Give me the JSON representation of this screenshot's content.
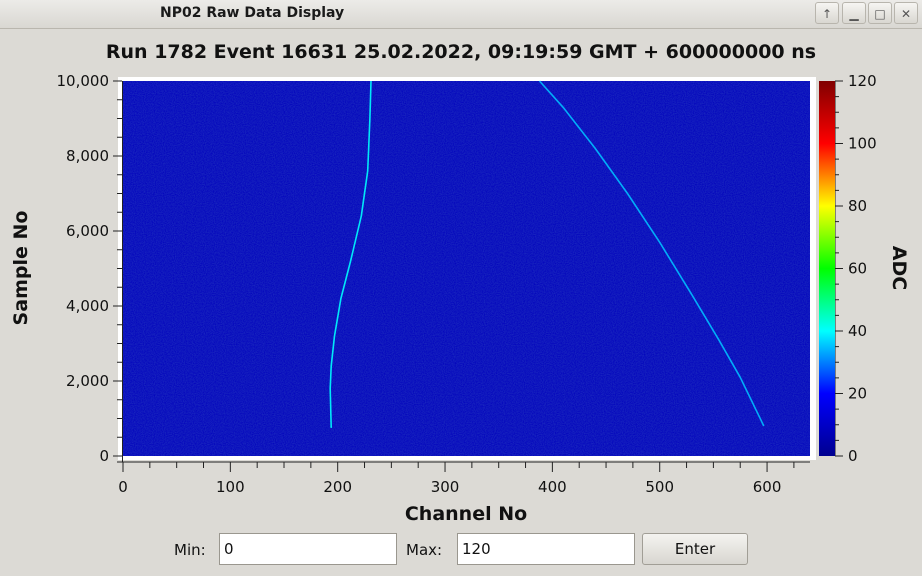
{
  "window": {
    "title": "NP02 Raw Data Display",
    "buttons": {
      "up": "↑",
      "minimize": "▁",
      "maximize": "□",
      "close": "✕"
    }
  },
  "plot": {
    "title": "Run 1782 Event 16631 25.02.2022, 09:19:59 GMT + 600000000 ns"
  },
  "chart_data": {
    "type": "heatmap",
    "title": "Run 1782 Event 16631 25.02.2022, 09:19:59 GMT + 600000000 ns",
    "xlabel": "Channel No",
    "ylabel": "Sample No",
    "zlabel": "ADC",
    "xlim": [
      0,
      640
    ],
    "ylim": [
      0,
      10000
    ],
    "zlim": [
      0,
      120
    ],
    "x_ticks": [
      0,
      100,
      200,
      300,
      400,
      500,
      600
    ],
    "x_tick_labels": [
      "0",
      "100",
      "200",
      "300",
      "400",
      "500",
      "600"
    ],
    "y_ticks": [
      0,
      2000,
      4000,
      6000,
      8000,
      10000
    ],
    "y_tick_labels": [
      "0",
      "2,000",
      "4,000",
      "6,000",
      "8,000",
      "10,000"
    ],
    "z_ticks": [
      0,
      20,
      40,
      60,
      80,
      100,
      120
    ],
    "z_tick_labels": [
      "0",
      "20",
      "40",
      "60",
      "80",
      "100",
      "120"
    ],
    "colormap": [
      "#00008f",
      "#0000ff",
      "#00ffff",
      "#00ff00",
      "#ffff00",
      "#ff0000",
      "#800000"
    ],
    "background_value": 8,
    "tracks": [
      {
        "points": [
          [
            194,
            750
          ],
          [
            193,
            1800
          ],
          [
            194,
            2400
          ],
          [
            197,
            3200
          ],
          [
            203,
            4200
          ],
          [
            212,
            5200
          ],
          [
            222,
            6400
          ],
          [
            228,
            7600
          ],
          [
            230,
            9000
          ],
          [
            231,
            10000
          ]
        ],
        "value": 40
      },
      {
        "points": [
          [
            388,
            10000
          ],
          [
            410,
            9300
          ],
          [
            440,
            8200
          ],
          [
            470,
            7000
          ],
          [
            500,
            5700
          ],
          [
            530,
            4300
          ],
          [
            555,
            3100
          ],
          [
            575,
            2100
          ],
          [
            597,
            800
          ]
        ],
        "value": 35
      }
    ]
  },
  "controls": {
    "min_label": "Min:",
    "min_value": "0",
    "max_label": "Max:",
    "max_value": "120",
    "enter_label": "Enter"
  }
}
